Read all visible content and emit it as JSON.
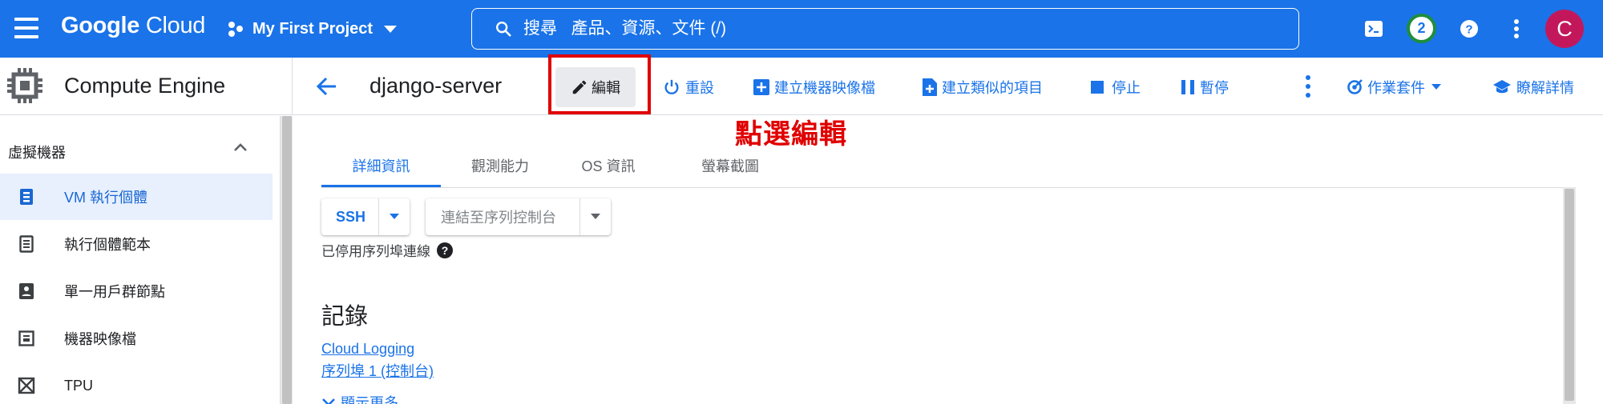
{
  "topbar": {
    "logo_google": "Google",
    "logo_cloud": " Cloud",
    "project_name": "My First Project",
    "search_placeholder": "搜尋   產品、資源、文件 (/)",
    "notification_count": "2",
    "avatar_initial": "C",
    "bg_color": "#1a73e8"
  },
  "header": {
    "product_title": "Compute Engine",
    "resource_title": "django-server",
    "actions": {
      "edit": "編輯",
      "reset": "重設",
      "create_machine_image": "建立機器映像檔",
      "create_similar": "建立類似的項目",
      "stop": "停止",
      "suspend": "暫停",
      "operations_suite": "作業套件",
      "learn_more": "瞭解詳情"
    }
  },
  "annotation": {
    "text": "點選編輯",
    "color": "#e00000"
  },
  "sidebar": {
    "section_title": "虛擬機器",
    "items": [
      {
        "label": "VM 執行個體",
        "icon": "vm-instance-icon",
        "active": true
      },
      {
        "label": "執行個體範本",
        "icon": "instance-template-icon",
        "active": false
      },
      {
        "label": "單一用戶群節點",
        "icon": "sole-tenant-node-icon",
        "active": false
      },
      {
        "label": "機器映像檔",
        "icon": "machine-image-icon",
        "active": false
      },
      {
        "label": "TPU",
        "icon": "tpu-icon",
        "active": false
      }
    ]
  },
  "main": {
    "tabs": [
      "詳細資訊",
      "觀測能力",
      "OS 資訊",
      "螢幕截圖"
    ],
    "active_tab": 0,
    "ssh_label": "SSH",
    "serial_console_label": "連結至序列控制台",
    "serial_status": "已停用序列埠連線",
    "logs_heading": "記錄",
    "links": {
      "cloud_logging": "Cloud Logging",
      "serial_port": "序列埠 1 (控制台)"
    },
    "show_more": "顯示更多"
  }
}
